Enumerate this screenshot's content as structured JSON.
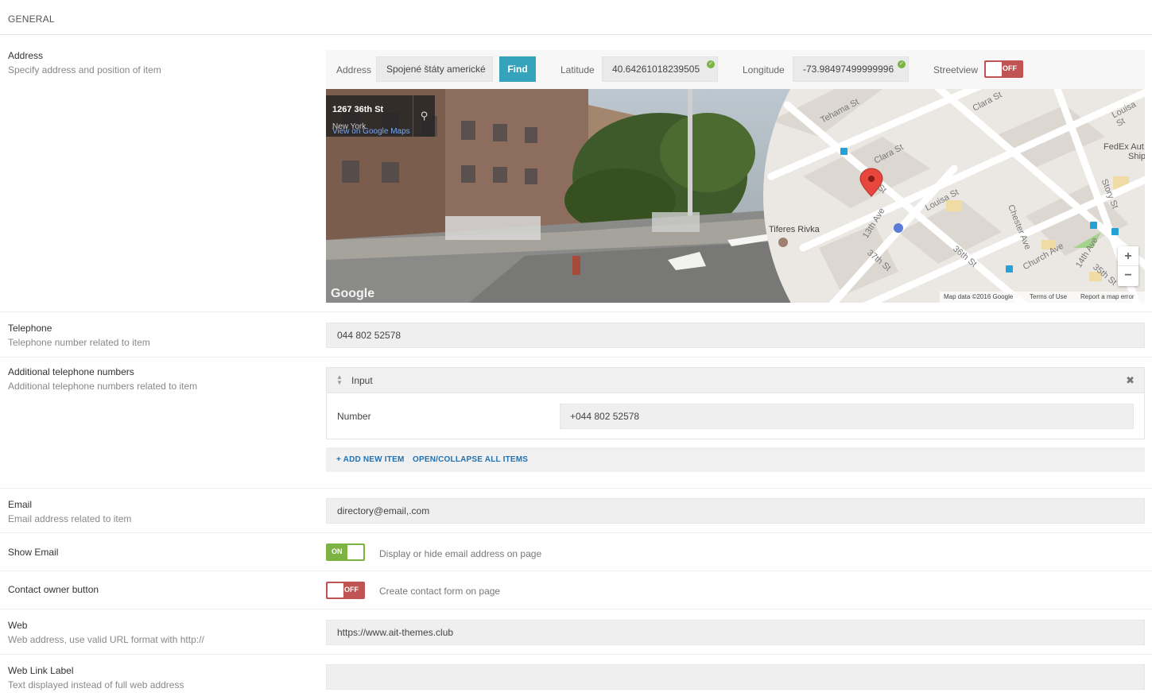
{
  "section": {
    "title": "GENERAL"
  },
  "address": {
    "title": "Address",
    "desc": "Specify address and position of item",
    "field_label": "Address",
    "field_value": "Spojené štáty americké",
    "find_label": "Find",
    "lat_label": "Latitude",
    "lat_value": "40.64261018239505",
    "lng_label": "Longitude",
    "lng_value": "-73.98497499999996",
    "streetview_label": "Streetview",
    "streetview_state": "OFF",
    "map": {
      "sv_address": "1267 36th St",
      "sv_city": "New York",
      "sv_link": "View on Google Maps",
      "google": "Google",
      "place": "Tiferes Rivka",
      "streets": [
        "Tehama St",
        "Clara St",
        "Clara St",
        "Louisa St",
        "Louisa St",
        "13th Ave",
        "37th St",
        "36th St",
        "Chester Ave",
        "Church Ave",
        "14th Ave",
        "35th St",
        "Story St",
        "St"
      ],
      "fedex_1": "FedEx Aut",
      "fedex_2": "Ship",
      "zoom_in": "+",
      "zoom_out": "−",
      "attrib_data": "Map data ©2016 Google",
      "attrib_terms": "Terms of Use",
      "attrib_report": "Report a map error"
    }
  },
  "telephone": {
    "title": "Telephone",
    "desc": "Telephone number related to item",
    "value": "044 802 52578"
  },
  "additional": {
    "title": "Additional telephone numbers",
    "desc": "Additional telephone numbers related to item",
    "item_title": "Input",
    "number_label": "Number",
    "number_value": "+044 802 52578",
    "add_label": "+ ADD NEW ITEM",
    "toggle_all_label": "OPEN/COLLAPSE ALL ITEMS"
  },
  "email": {
    "title": "Email",
    "desc": "Email address related to item",
    "value": "directory@email,.com"
  },
  "show_email": {
    "title": "Show Email",
    "state": "ON",
    "desc": "Display or hide email address on page"
  },
  "contact_owner": {
    "title": "Contact owner button",
    "state": "OFF",
    "desc": "Create contact form on page"
  },
  "web": {
    "title": "Web",
    "desc": "Web address, use valid URL format with http://",
    "value": "https://www.ait-themes.club"
  },
  "web_label": {
    "title": "Web Link Label",
    "desc": "Text displayed instead of full web address",
    "value": ""
  },
  "colors": {
    "accent": "#34a3bb",
    "on": "#7cb342",
    "off": "#c05353",
    "link": "#2271b1"
  }
}
